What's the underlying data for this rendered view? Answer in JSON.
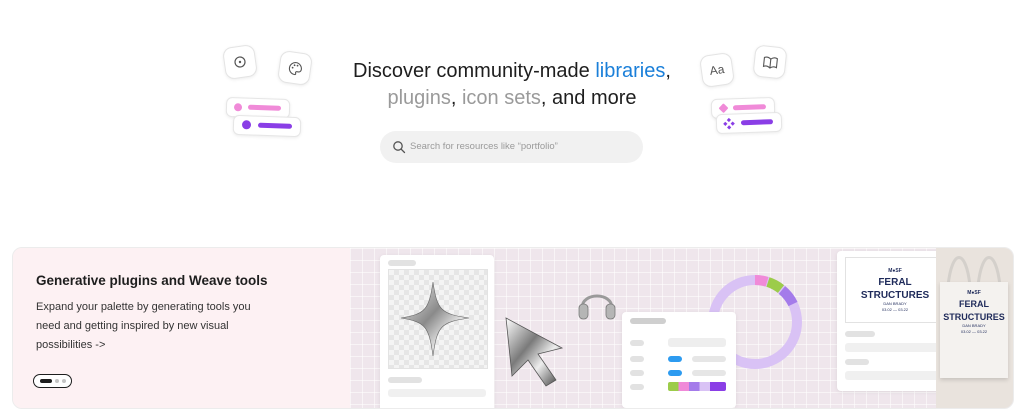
{
  "hero": {
    "headline_part1": "Discover community-made ",
    "headline_libraries": "libraries",
    "headline_comma1": ",",
    "headline_plugins": "plugins",
    "headline_comma2": ", ",
    "headline_iconsets": "icon sets",
    "headline_tail": ", and more"
  },
  "search": {
    "placeholder": "Search for resources like “portfolio”"
  },
  "decor": {
    "left_icons": [
      "widget-icon",
      "palette-icon"
    ],
    "right_icons": [
      "font-icon",
      "book-icon"
    ],
    "font_tile_label": "Aa"
  },
  "banner": {
    "title": "Generative plugins and Weave tools",
    "description": "Expand your palette by generating tools you need and getting inspired by new visual possibilities ->",
    "slides": 3,
    "active_slide": 1
  },
  "artwork": {
    "poster_brand": "M●SF",
    "poster_title_line1": "FERAL",
    "poster_title_line2": "STRUCTURES",
    "poster_subtitle": "DAN BRADY",
    "poster_dates": "03.02 — 03.22"
  },
  "colors": {
    "accent_blue": "#1a7fd9",
    "pink": "#f08ad8",
    "purple": "#8a3ee6",
    "muted_grey": "#9a9a9a"
  }
}
